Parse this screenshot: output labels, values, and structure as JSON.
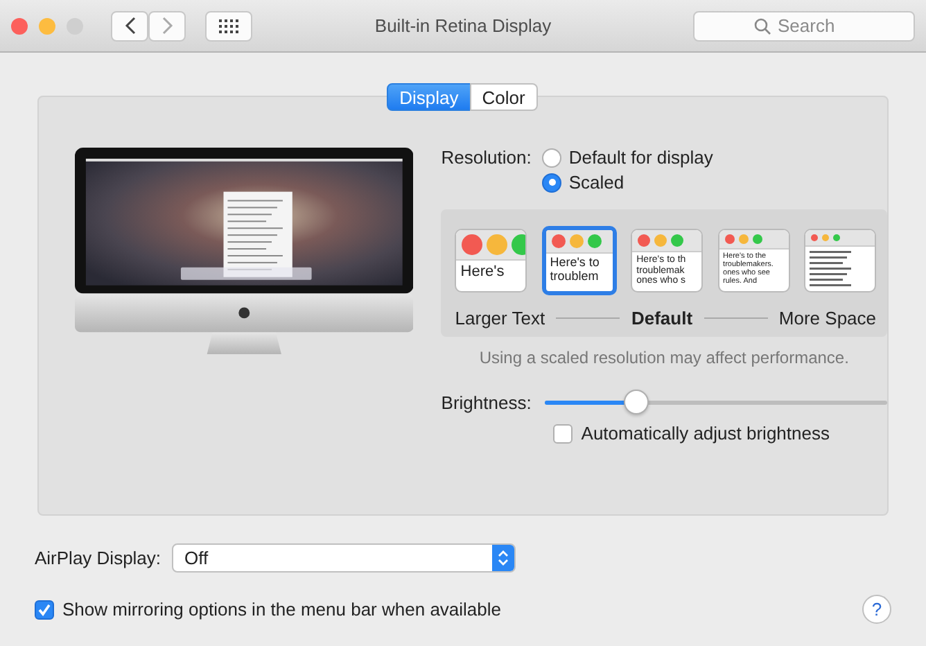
{
  "window": {
    "title": "Built-in Retina Display"
  },
  "search": {
    "placeholder": "Search"
  },
  "tabs": [
    {
      "label": "Display",
      "selected": true
    },
    {
      "label": "Color",
      "selected": false
    }
  ],
  "resolution": {
    "label": "Resolution:",
    "options": [
      {
        "label": "Default for display",
        "selected": false
      },
      {
        "label": "Scaled",
        "selected": true
      }
    ]
  },
  "scale_options": [
    {
      "kind": "text",
      "selected": false,
      "lines": [
        "Here's"
      ]
    },
    {
      "kind": "text",
      "selected": true,
      "lines": [
        "Here's to",
        "troublem"
      ]
    },
    {
      "kind": "text",
      "selected": false,
      "lines": [
        "Here's to th",
        "troublemak",
        "ones who s"
      ]
    },
    {
      "kind": "text",
      "selected": false,
      "lines": [
        "Here's to the",
        "troublemakers.",
        "ones who see",
        "rules. And"
      ]
    },
    {
      "kind": "lines",
      "selected": false
    }
  ],
  "scale_labels": {
    "left": "Larger Text",
    "center": "Default",
    "right": "More Space"
  },
  "scale_note": "Using a scaled resolution may affect performance.",
  "brightness": {
    "label": "Brightness:",
    "level": 0.25
  },
  "auto_brightness": {
    "label": "Automatically adjust brightness",
    "checked": false
  },
  "airplay": {
    "label": "AirPlay Display:",
    "value": "Off"
  },
  "mirroring": {
    "label": "Show mirroring options in the menu bar when available",
    "checked": true
  },
  "help": {
    "label": "?"
  }
}
